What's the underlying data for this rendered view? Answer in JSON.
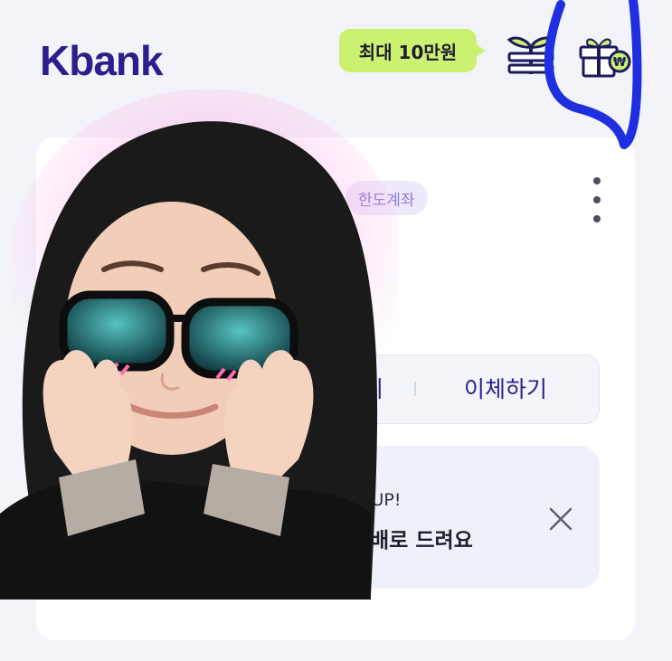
{
  "header": {
    "logo_text": "Kbank",
    "promo_badge": "최대 10만원",
    "icons": [
      "plant-icon",
      "gift-won-icon"
    ]
  },
  "card": {
    "limit_badge": "한도계좌",
    "menu_icon": "more-vert-icon",
    "actions": {
      "left_partial": "기",
      "transfer": "이체하기"
    },
    "banner": {
      "subtitle_partial": "혜택은 UP!",
      "title_partial": "20배로 드려요",
      "close_icon": "close-icon"
    }
  },
  "overlay": {
    "avatar": "sticker-avatar",
    "annotation": "blue-hand-drawn-circle"
  },
  "colors": {
    "brand": "#2c1e8c",
    "promo_bg": "#ccf070",
    "page_bg": "#f3f4f9",
    "annotation": "#1f2fe0"
  }
}
